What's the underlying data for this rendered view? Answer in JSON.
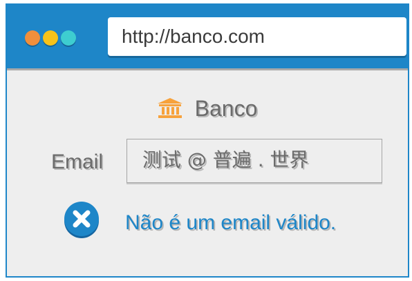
{
  "browser": {
    "url": "http://banco.com",
    "traffic_lights": [
      {
        "name": "close-dot",
        "color": "#f08f3c"
      },
      {
        "name": "minimize-dot",
        "color": "#f7c31a"
      },
      {
        "name": "maximize-dot",
        "color": "#3ecdd0"
      }
    ],
    "accent_color": "#1e86c8"
  },
  "page": {
    "brand": {
      "icon": "bank-icon",
      "icon_color": "#f7a23c",
      "name": "Banco"
    },
    "form": {
      "email_label": "Email",
      "email_value": "测试 @ 普遍 . 世界"
    },
    "validation": {
      "icon": "error-x-icon",
      "message": "Não é um email válido."
    }
  }
}
